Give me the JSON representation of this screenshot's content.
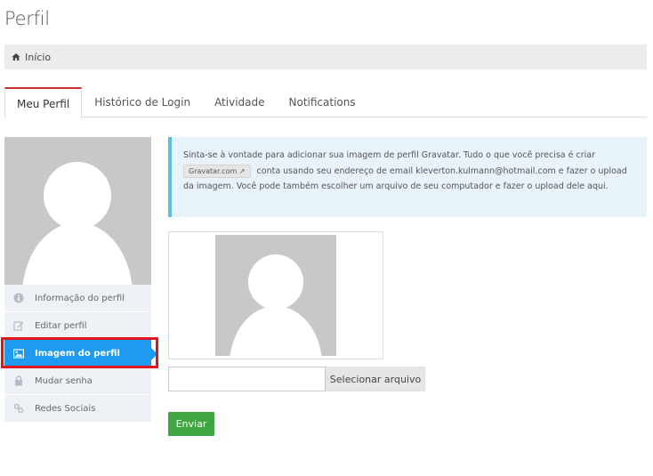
{
  "page": {
    "title": "Perfil"
  },
  "breadcrumb": {
    "home_label": "Início"
  },
  "tabs": [
    {
      "label": "Meu Perfil",
      "active": true
    },
    {
      "label": "Histórico de Login",
      "active": false
    },
    {
      "label": "Atividade",
      "active": false
    },
    {
      "label": "Notifications",
      "active": false
    }
  ],
  "sidebar": {
    "items": [
      {
        "label": "Informação do perfil",
        "icon": "info-icon"
      },
      {
        "label": "Editar perfil",
        "icon": "edit-icon"
      },
      {
        "label": "Imagem do perfil",
        "icon": "image-icon",
        "active": true
      },
      {
        "label": "Mudar senha",
        "icon": "lock-icon"
      },
      {
        "label": "Redes Sociais",
        "icon": "link-icon"
      }
    ]
  },
  "info": {
    "text_before": "Sinta-se à vontade para adicionar sua imagem de perfil Gravatar. Tudo o que você precisa é criar",
    "gravatar_label": "Gravatar.com",
    "text_after": "conta usando seu endereço de email kleverton.kulmann@hotmail.com e fazer o upload da imagem. Você pode também escolher um arquivo de seu computador e fazer o upload dele aqui."
  },
  "upload": {
    "file_button_label": "Selecionar arquivo",
    "submit_label": "Enviar"
  },
  "colors": {
    "active_tab_border": "#c9302c",
    "sidebar_active": "#1e9bf0",
    "info_border": "#5bc0de",
    "submit": "#3fa542",
    "highlight": "#e0141e"
  }
}
